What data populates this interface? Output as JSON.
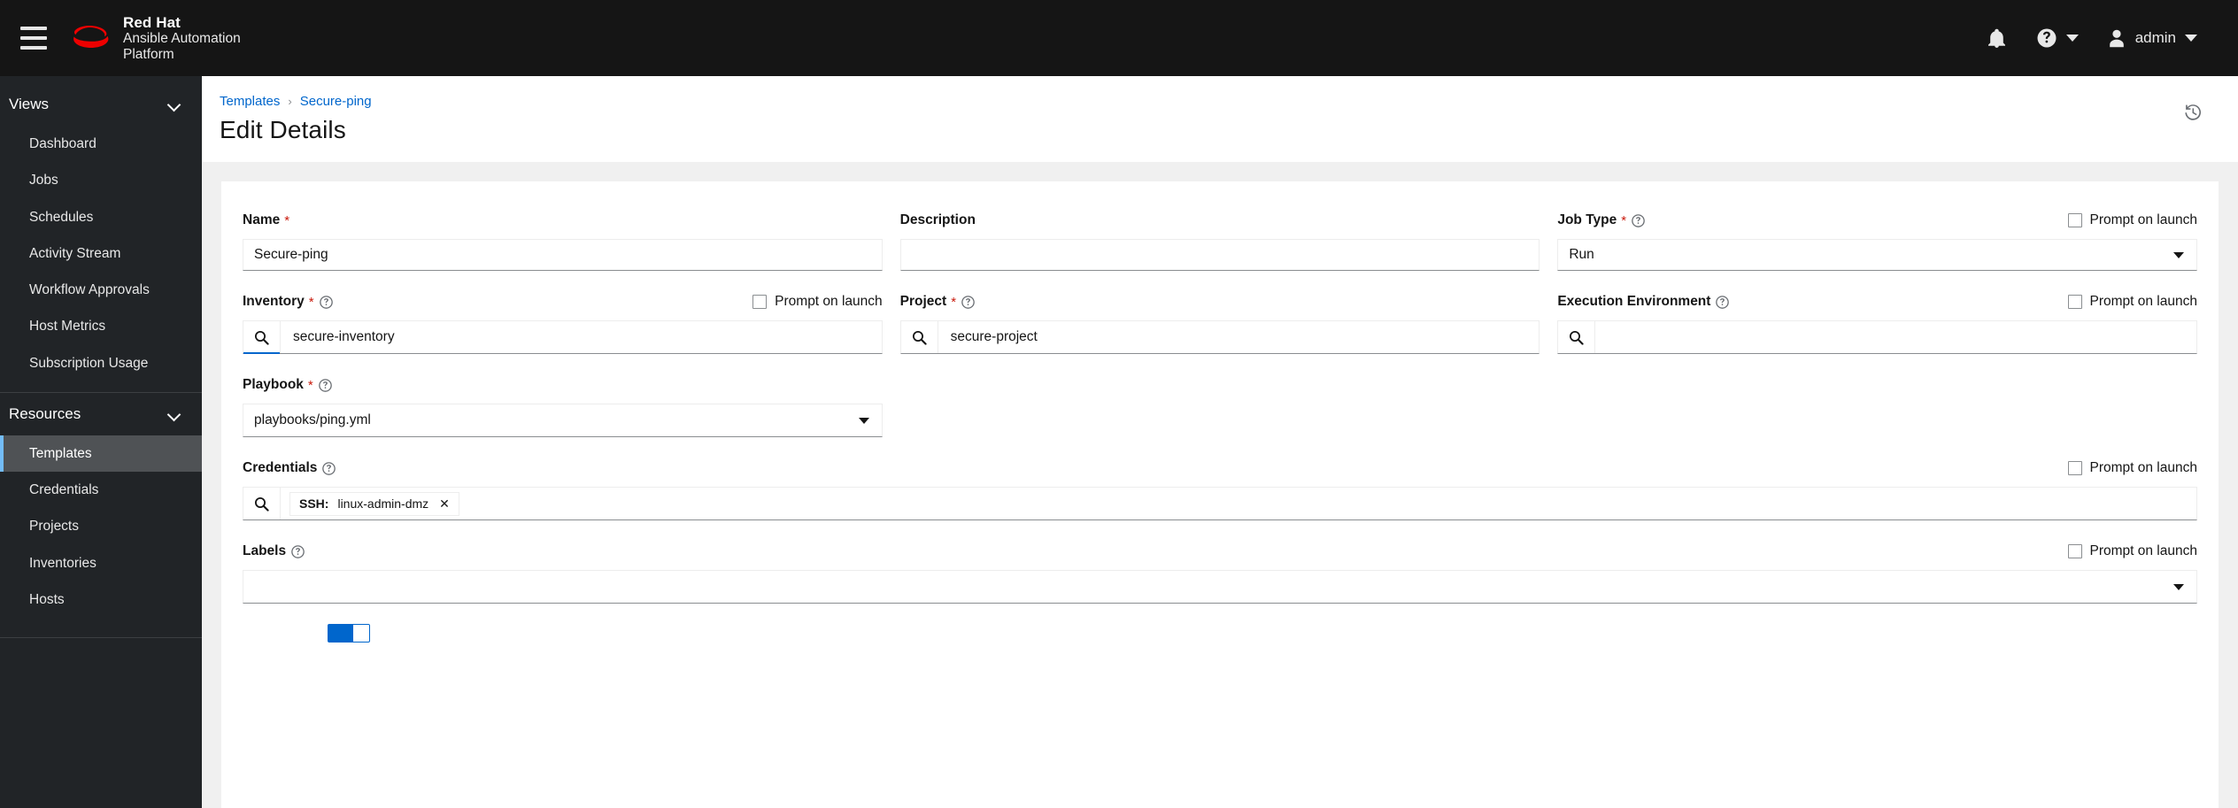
{
  "masthead": {
    "menu_icon": "hamburger-icon",
    "brand": {
      "red_hat": "Red Hat",
      "line1": "Ansible Automation",
      "line2": "Platform"
    },
    "notifications_icon": "bell-icon",
    "help_icon": "question-circle-icon",
    "user_icon": "user-icon",
    "user_name": "admin"
  },
  "sidebar": {
    "groups": [
      {
        "label": "Views",
        "items": [
          {
            "label": "Dashboard",
            "active": false
          },
          {
            "label": "Jobs",
            "active": false
          },
          {
            "label": "Schedules",
            "active": false
          },
          {
            "label": "Activity Stream",
            "active": false
          },
          {
            "label": "Workflow Approvals",
            "active": false
          },
          {
            "label": "Host Metrics",
            "active": false
          },
          {
            "label": "Subscription Usage",
            "active": false
          }
        ]
      },
      {
        "label": "Resources",
        "items": [
          {
            "label": "Templates",
            "active": true
          },
          {
            "label": "Credentials",
            "active": false
          },
          {
            "label": "Projects",
            "active": false
          },
          {
            "label": "Inventories",
            "active": false
          },
          {
            "label": "Hosts",
            "active": false
          }
        ]
      }
    ]
  },
  "page": {
    "breadcrumb": {
      "parent": "Templates",
      "separator": "›",
      "current": "Secure-ping"
    },
    "title": "Edit Details",
    "history_icon": "history-icon"
  },
  "form": {
    "prompt_on_launch_label": "Prompt on launch",
    "help_icon": "question-circle-icon",
    "search_icon": "search-icon",
    "required_marker": "*",
    "fields": {
      "name": {
        "label": "Name",
        "required": true,
        "value": "Secure-ping"
      },
      "description": {
        "label": "Description",
        "required": false,
        "value": ""
      },
      "job_type": {
        "label": "Job Type",
        "required": true,
        "value": "Run",
        "prompt_on_launch": false
      },
      "inventory": {
        "label": "Inventory",
        "required": true,
        "value": "secure-inventory",
        "prompt_on_launch": false
      },
      "project": {
        "label": "Project",
        "required": true,
        "value": "secure-project"
      },
      "execution_environment": {
        "label": "Execution Environment",
        "required": false,
        "value": "",
        "prompt_on_launch": false
      },
      "playbook": {
        "label": "Playbook",
        "required": true,
        "value": "playbooks/ping.yml"
      },
      "credentials": {
        "label": "Credentials",
        "required": false,
        "prompt_on_launch": false,
        "chips": [
          {
            "type": "SSH:",
            "name": "linux-admin-dmz",
            "remove_icon": "close-icon"
          }
        ]
      },
      "labels": {
        "label": "Labels",
        "required": false,
        "value": "",
        "prompt_on_launch": false
      }
    }
  }
}
